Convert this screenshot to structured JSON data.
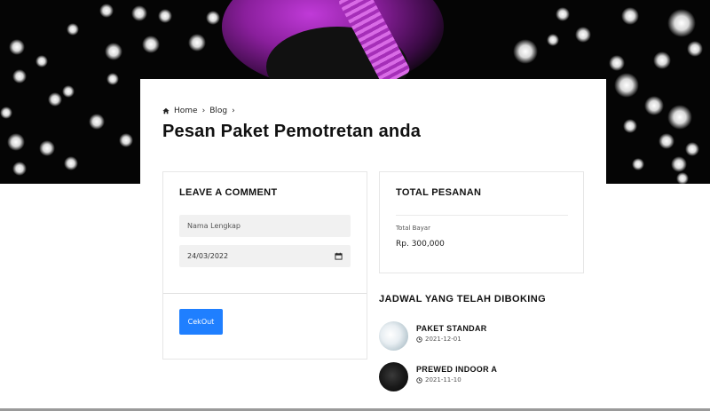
{
  "breadcrumb": {
    "home_label": "Home",
    "sep1": "›",
    "blog_label": "Blog",
    "sep2": "›"
  },
  "page_title": "Pesan Paket Pemotretan anda",
  "comment_form": {
    "title": "LEAVE A COMMENT",
    "name_placeholder": "Nama Lengkap",
    "date_value": "24/03/2022",
    "submit_label": "CekOut"
  },
  "order_total": {
    "title": "TOTAL PESANAN",
    "label": "Total Bayar",
    "value": "Rp. 300,000"
  },
  "schedule": {
    "title": "JADWAL YANG TELAH DIBOKING",
    "items": [
      {
        "name": "PAKET STANDAR",
        "date": "2021-12-01"
      },
      {
        "name": "PREWED INDOOR A",
        "date": "2021-11-10"
      }
    ]
  },
  "colors": {
    "accent": "#1f7fff",
    "hero_background": "#050505",
    "hero_highlight": "#c03ad8"
  },
  "icons": {
    "home": "home-icon",
    "calendar": "calendar-icon",
    "clock": "clock-icon"
  }
}
